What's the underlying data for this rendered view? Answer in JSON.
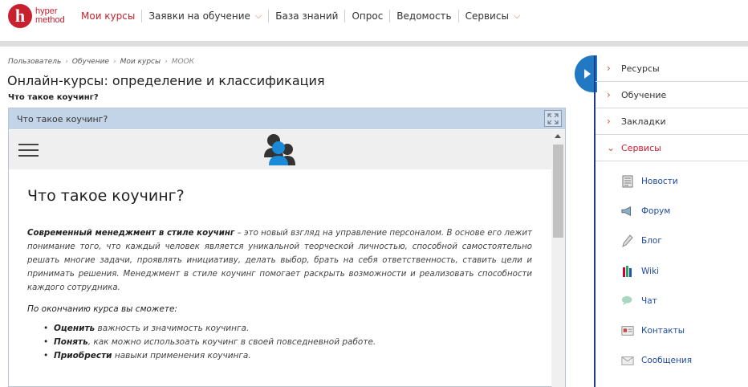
{
  "logo": {
    "mark": "h",
    "line1": "hyper",
    "line2": "method"
  },
  "nav": [
    {
      "label": "Мои курсы",
      "chevron": false
    },
    {
      "label": "Заявки на обучение",
      "chevron": true
    },
    {
      "label": "База знаний",
      "chevron": false
    },
    {
      "label": "Опрос",
      "chevron": false
    },
    {
      "label": "Ведомость",
      "chevron": false
    },
    {
      "label": "Сервисы",
      "chevron": true
    }
  ],
  "breadcrumb": [
    "Пользователь",
    "Обучение",
    "Мои курсы",
    "МООК"
  ],
  "page_title": "Онлайн-курсы: определение и классификация",
  "subtitle": "Что такое коучинг?",
  "module": {
    "header": "Что такое коучинг?",
    "heading": "Что такое коучинг?",
    "para_bold": "Современный менеджмент в стиле коучинг",
    "para_rest": " – это новый взгляд на управление персоналом. В основе его лежит понимание того, что каждый человек является уникальной теорческой личностью, способной самостоятельно решать многие задачи, проявлять инициативу, делать выбор, брать на себя ответственность, ставить цели и принимать решения. Менеджмент в стиле коучинг помогает раскрыть возможности и реализовать способности каждого сотрудника.",
    "outcomes": "По окончанию курса вы сможете:",
    "bullets": [
      {
        "bold": "Оценить",
        "rest": " важность и значимость коучинга."
      },
      {
        "bold": "Понять",
        "rest": ", как можно использоать коучинг в своей повседневной работе."
      },
      {
        "bold": "Приобрести",
        "rest": " навыки применения коучинга."
      }
    ]
  },
  "sidebar": {
    "sections": [
      "Ресурсы",
      "Обучение",
      "Закладки",
      "Сервисы"
    ],
    "items": [
      {
        "label": "Новости",
        "icon": "news-icon"
      },
      {
        "label": "Форум",
        "icon": "forum-icon"
      },
      {
        "label": "Блог",
        "icon": "blog-icon"
      },
      {
        "label": "Wiki",
        "icon": "wiki-icon"
      },
      {
        "label": "Чат",
        "icon": "chat-icon"
      },
      {
        "label": "Контакты",
        "icon": "contacts-icon"
      },
      {
        "label": "Сообщения",
        "icon": "messages-icon"
      }
    ]
  },
  "colors": {
    "brand": "#c8202f",
    "accent": "#2179c3",
    "link": "#1f4ba0",
    "module_header": "#c3d3e8"
  }
}
